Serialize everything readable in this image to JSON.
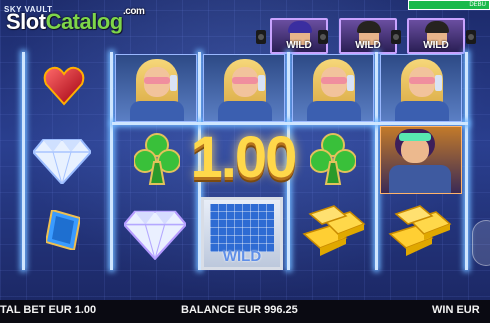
{
  "header": {
    "game_name": "SKY VAULT",
    "logo_text_slot": "Slot",
    "logo_text_catalog": "Catalog",
    "logo_domain": ".com",
    "debug_label": "DEBU"
  },
  "top_wilds": [
    {
      "label": "WILD"
    },
    {
      "label": "WILD"
    },
    {
      "label": "WILD"
    }
  ],
  "reels": {
    "row1": [
      "ruby-heart",
      "woman-blonde",
      "woman-blonde",
      "woman-blonde",
      "woman-blonde"
    ],
    "row2": [
      "diamond",
      "clubs",
      "clubs",
      "clubs",
      "woman-goggles"
    ],
    "row3": [
      "blue-gem",
      "diamond",
      "blueprint-wild",
      "gold-bars",
      "gold-bars"
    ]
  },
  "blueprint_wild_label": "WILD",
  "win_display": "1.00",
  "colors": {
    "neon_line": "#cfe6ff",
    "win_gold": "#ffd84a",
    "debug_green": "#19b94a"
  },
  "bottom_bar": {
    "total_bet": "TAL BET EUR 1.00",
    "balance": "BALANCE EUR 996.25",
    "win": "WIN EUR"
  }
}
